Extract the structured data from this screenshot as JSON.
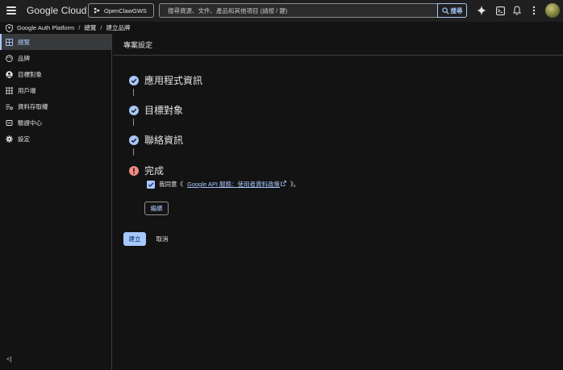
{
  "topbar": {
    "brand": "Google Cloud",
    "project": "OpenClawGWS",
    "search_placeholder": "搜尋資源、文件、產品和其他項目 (請按 / 鍵)",
    "search_button": "搜尋"
  },
  "breadcrumb": {
    "product": "Google Auth Platform",
    "section": "總覽",
    "page": "建立品牌",
    "sep": "/"
  },
  "sidebar": {
    "items": [
      {
        "label": "總覽",
        "icon": "dashboard-icon",
        "active": true
      },
      {
        "label": "品牌",
        "icon": "palette-icon"
      },
      {
        "label": "目標對象",
        "icon": "account-circle-icon"
      },
      {
        "label": "用戶端",
        "icon": "grid-apps-icon"
      },
      {
        "label": "資料存取權",
        "icon": "data-access-icon"
      },
      {
        "label": "驗證中心",
        "icon": "verification-icon"
      },
      {
        "label": "設定",
        "icon": "gear-icon"
      }
    ],
    "collapse": "<|"
  },
  "main": {
    "title": "專案設定",
    "steps": [
      {
        "title": "應用程式資訊",
        "status": "done"
      },
      {
        "title": "目標對象",
        "status": "done"
      },
      {
        "title": "聯絡資訊",
        "status": "done"
      },
      {
        "title": "完成",
        "status": "error"
      }
    ],
    "consent": {
      "prefix": "我同意《",
      "link": "Google API 服務：使用者資料政策",
      "suffix": "》。",
      "checked": true
    },
    "edit_button": "繼續",
    "create_button": "建立",
    "cancel_button": "取消"
  },
  "colors": {
    "accent": "#a8c7fa",
    "error": "#f28b82",
    "background": "#131314"
  }
}
